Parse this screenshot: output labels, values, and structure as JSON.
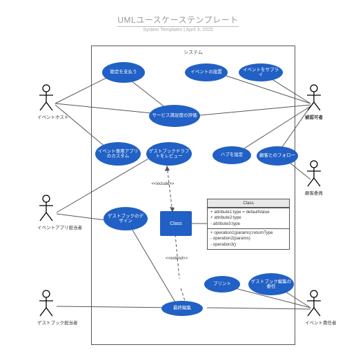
{
  "header": {
    "title": "UMLユースケーステンプレート",
    "meta": "System Templates | April 3, 2025"
  },
  "system": {
    "label": "システム"
  },
  "actors": {
    "a1": "イベントホスト",
    "a2": "イベントアプリ担当者",
    "a3": "ゲストブック担当者",
    "a4": "被認可者",
    "a5": "顧客委員",
    "a6": "イベント責任者"
  },
  "usecases": {
    "uc1": "勘定を支払う",
    "uc2": "イベントの設置",
    "uc3": "イベントをサプライ",
    "uc4": "サービス満足度の評価",
    "uc5": "イベント専用アプリのカスタム",
    "uc6": "ゲストブックドラフトをレビュー",
    "uc7": "ハブを設定",
    "uc8": "顧客とのフォロー",
    "uc9": "ゲストブックのデザイン",
    "uc10": "プリント",
    "uc11": "ゲストブック編集の委任",
    "uc12": "最終編集",
    "classNode": "Class"
  },
  "stereo": {
    "include": "<<include>>",
    "extend": "<<extend>>"
  },
  "classBox": {
    "title": "Class",
    "attrs": [
      "+ attribute1:type = defaultValue",
      "+ attribute2:type",
      "- attribute3:type"
    ],
    "ops": [
      "+ operation1(params):returnType",
      "- operation2(params)",
      "- operation3()"
    ]
  }
}
